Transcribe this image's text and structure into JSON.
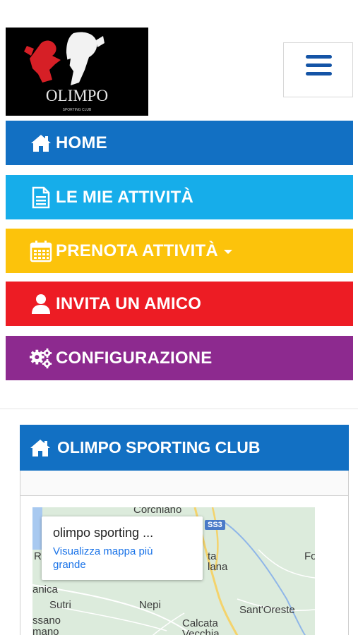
{
  "header": {
    "logo_text": "OLIMPO",
    "logo_subtext": "SPORTING CLUB"
  },
  "menu": {
    "items": [
      {
        "label": "HOME",
        "icon": "home-icon",
        "color": "#1270c3"
      },
      {
        "label": "LE MIE ATTIVITÀ",
        "icon": "document-icon",
        "color": "#16adea"
      },
      {
        "label": "PRENOTA ATTIVITÀ",
        "icon": "calendar-icon",
        "color": "#fcc30b",
        "has_dropdown": true
      },
      {
        "label": "INVITA UN AMICO",
        "icon": "user-icon",
        "color": "#ed1c24"
      },
      {
        "label": "CONFIGURAZIONE",
        "icon": "gears-icon",
        "color": "#8d2a8f"
      }
    ]
  },
  "panel": {
    "title": "OLIMPO SPORTING CLUB",
    "icon": "home-icon",
    "color": "#1270c3"
  },
  "map": {
    "place_name": "olimpo sporting ...",
    "link_text": "Visualizza mappa più grande",
    "road_shield": "SS3",
    "labels": {
      "corchiano": "Corchiano",
      "ro": "Ro",
      "ta": "ta",
      "lana": "lana",
      "fo": "Fo",
      "anica": "anica",
      "sutri": "Sutri",
      "nepi": "Nepi",
      "santoreste": "Sant'Oreste",
      "ssano": "ssano",
      "calcata": "Calcata",
      "mano": "mano",
      "vecchia": "Vecchia"
    }
  }
}
